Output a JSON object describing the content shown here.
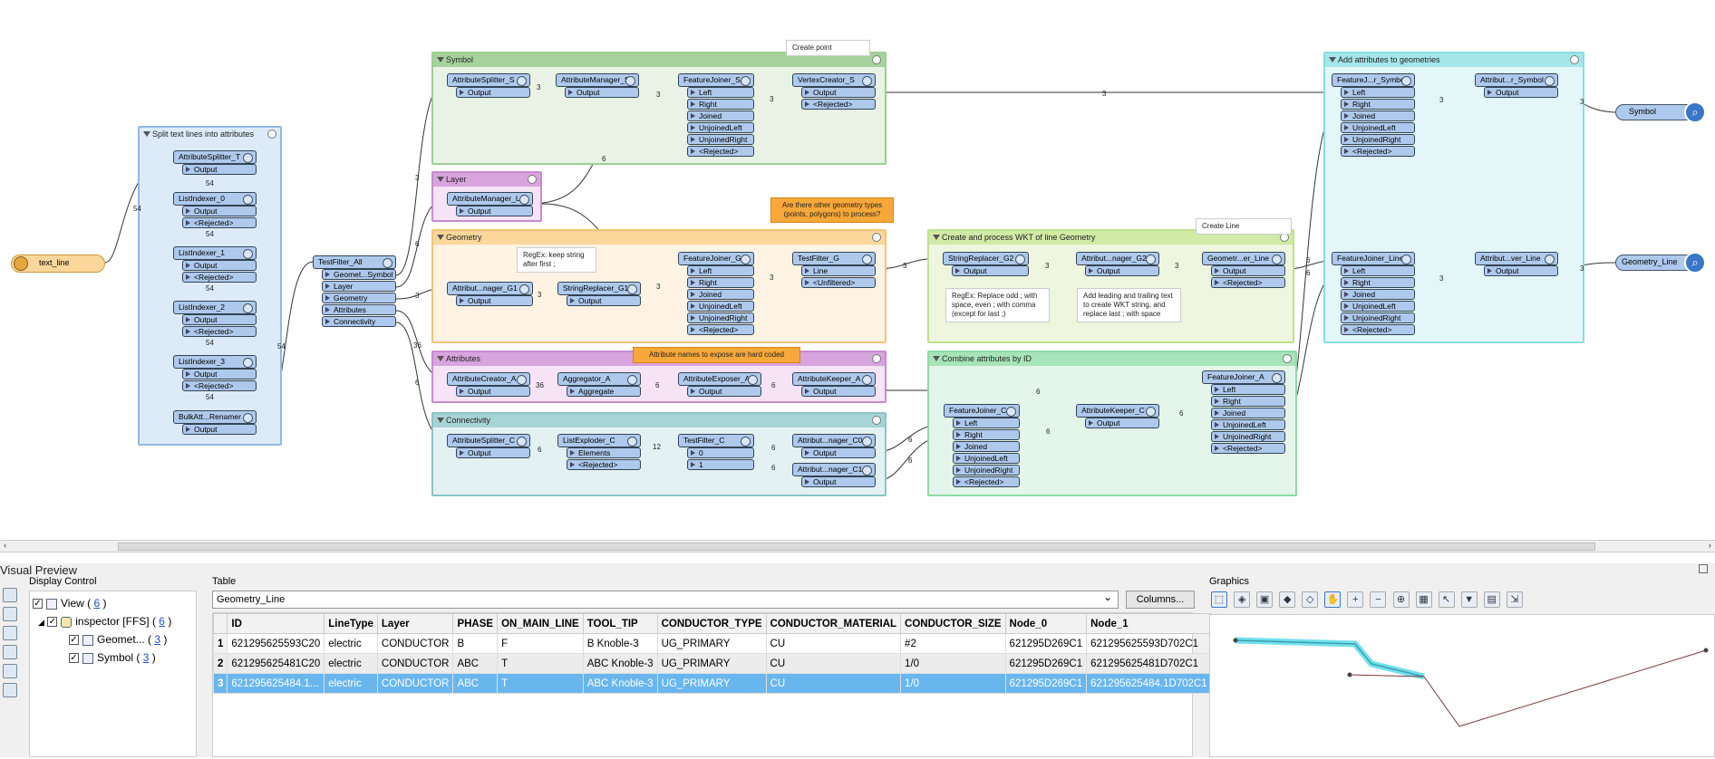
{
  "canvas": {
    "bookmarks": {
      "split": "Split text lines into attributes",
      "symbol": "Symbol",
      "layer": "Layer",
      "geometry": "Geometry",
      "attributes": "Attributes",
      "connectivity": "Connectivity",
      "wkt": "Create and process WKT of line Geometry",
      "combine": "Combine attributes by ID",
      "addattr": "Add attributes to geometries"
    },
    "reader": "text_line",
    "writers": {
      "symbol": "Symbol",
      "geometry": "Geometry_Line"
    },
    "notes": {
      "create_point": "Create point",
      "other_geom": "Are there other geometry types (points, polygons) to process?",
      "regex_keep": "RegEx: keep string after first ;",
      "attr_names": "Attribute names to expose are hard coded",
      "create_line": "Create Line",
      "regex_replace": "RegEx: Replace odd ; with space, even ; with comma (except for last ;)",
      "leading_trailing": "Add leading and trailing text to create WKT string, and replace last ; with space"
    },
    "transformers": {
      "attributesplitter_t": "AttributeSplitter_T",
      "listindexer_0": "ListIndexer_0",
      "listindexer_1": "ListIndexer_1",
      "listindexer_2": "ListIndexer_2",
      "listindexer_3": "ListIndexer_3",
      "bulkrenamer": "BulkAtt...Renamer",
      "testfilter_all": "TestFilter_All",
      "attributesplitter_s": "AttributeSplitter_S",
      "attributemanager_s": "AttributeManager_S",
      "featurejoiner_s": "FeatureJoiner_S",
      "vertexcreator_s": "VertexCreator_S",
      "attributemanager_l": "AttributeManager_L",
      "attributemanager_g1": "Attribut...nager_G1",
      "stringreplacer_g1": "StringReplacer_G1",
      "featurejoiner_g": "FeatureJoiner_G",
      "testfilter_g": "TestFilter_G",
      "attributecreator_a": "AttributeCreator_A",
      "aggregator_a": "Aggregator_A",
      "attributeexposer_a": "AttributeExposer_A",
      "attributekeeper_a": "AttributeKeeper_A",
      "attributesplitter_c": "AttributeSplitter_C",
      "listexploder_c": "ListExploder_C",
      "testfilter_c": "TestFilter_C",
      "attributemanager_c0": "Attribut...nager_C0",
      "attributemanager_c1": "Attribut...nager_C1",
      "stringreplacer_g2": "StringReplacer_G2",
      "attributemanager_g2": "Attribut...nager_G2",
      "geometryreplacer_line": "Geometr...er_Line",
      "featurejoiner_c": "FeatureJoiner_C",
      "attributekeeper_c": "AttributeKeeper_C",
      "featurejoiner_a": "FeatureJoiner_A",
      "featurejoiner_symbol": "FeatureJ...r_Symbol",
      "attributemanager_symbol": "Attribut...r_Symbol",
      "featurejoiner_line": "FeatureJoiner_Line",
      "attributemanager_line": "Attribut...ver_Line"
    },
    "ports": {
      "output": "Output",
      "rejected": "<Rejected>",
      "left": "Left",
      "right": "Right",
      "joined": "Joined",
      "unjoinedleft": "UnjoinedLeft",
      "unjoinedright": "UnjoinedRight",
      "line": "Line",
      "unfiltered": "<Unfiltered>",
      "aggregate": "Aggregate",
      "elements": "Elements",
      "zero": "0",
      "one": "1",
      "geomsymbol": "Geomet...Symbol",
      "layer": "Layer",
      "geometry": "Geometry",
      "attributes": "Attributes",
      "connectivity": "Connectivity"
    },
    "counts": {
      "c54": "54",
      "c3": "3",
      "c6": "6",
      "c36": "36",
      "c12": "12"
    }
  },
  "visual_preview": {
    "title": "Visual Preview",
    "display_control": {
      "title": "Display Control",
      "view_label": "View (",
      "view_count": "6",
      "inspector_label": "inspector [FFS] (",
      "inspector_count": "6",
      "geom_label": "Geomet... (",
      "geom_count": "3",
      "symbol_label": "Symbol (",
      "symbol_count": "3",
      "close_paren": ")"
    },
    "table": {
      "title": "Table",
      "selected": "Geometry_Line",
      "columns_button": "Columns...",
      "headers": [
        "ID",
        "LineType",
        "Layer",
        "PHASE",
        "ON_MAIN_LINE",
        "TOOL_TIP",
        "CONDUCTOR_TYPE",
        "CONDUCTOR_MATERIAL",
        "CONDUCTOR_SIZE",
        "Node_0",
        "Node_1"
      ],
      "rows": [
        [
          "1",
          "621295625593C20",
          "electric",
          "CONDUCTOR",
          "B",
          "F",
          "B Knoble-3",
          "UG_PRIMARY",
          "CU",
          "#2",
          "621295D269C1",
          "621295625593D702C1"
        ],
        [
          "2",
          "621295625481C20",
          "electric",
          "CONDUCTOR",
          "ABC",
          "T",
          "ABC Knoble-3",
          "UG_PRIMARY",
          "CU",
          "1/0",
          "621295D269C1",
          "621295625481D702C1"
        ],
        [
          "3",
          "621295625484.1...",
          "electric",
          "CONDUCTOR",
          "ABC",
          "T",
          "ABC Knoble-3",
          "UG_PRIMARY",
          "CU",
          "1/0",
          "621295D269C1",
          "621295625484.1D702C1"
        ]
      ]
    },
    "graphics": {
      "title": "Graphics"
    }
  },
  "colors": {
    "symbol_bm": "#e8f3e5",
    "layer_bm": "#f5e3f6",
    "geometry_bm": "#fff4e3",
    "attributes_bm": "#f6e3f6",
    "connectivity_bm": "#e3f1f2",
    "wkt_bm": "#eef6df",
    "combine_bm": "#e4f6ea",
    "addattr_bm": "#e3f7f8",
    "split_bm": "#dcebf7",
    "selected_row": "#69b6ef",
    "highlight_line": "#4fd8e8"
  }
}
